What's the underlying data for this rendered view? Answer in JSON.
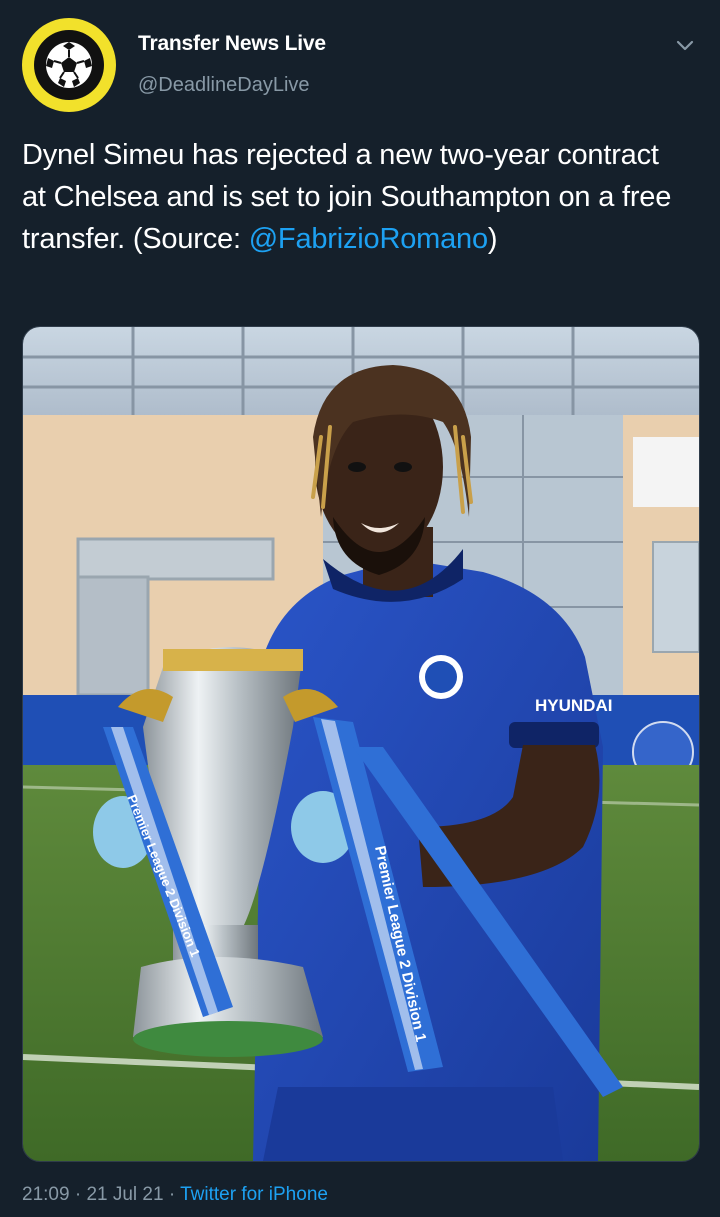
{
  "tweet": {
    "author_name": "Transfer News Live",
    "author_handle": "@DeadlineDayLive",
    "text_before": "Dynel Simeu has rejected a new two-year contract at Chelsea and is set to join Southampton on a free transfer. (Source: ",
    "mention": "@FabrizioRomano",
    "text_after": ")",
    "time": "21:09",
    "date": "21 Jul 21",
    "source": "Twitter for iPhone",
    "separator": " · "
  },
  "media": {
    "trophy_text_1": "Premier League 2 Division 1",
    "trophy_text_2": "Premier League 2 Division 1",
    "shirt_sponsor": "HYUNDAI"
  },
  "colors": {
    "background": "#15202b",
    "accent": "#1da1f2",
    "secondary_text": "#8899a6",
    "avatar_ring": "#f2e12b"
  },
  "icons": {
    "avatar": "football-icon",
    "menu": "chevron-down-icon"
  }
}
